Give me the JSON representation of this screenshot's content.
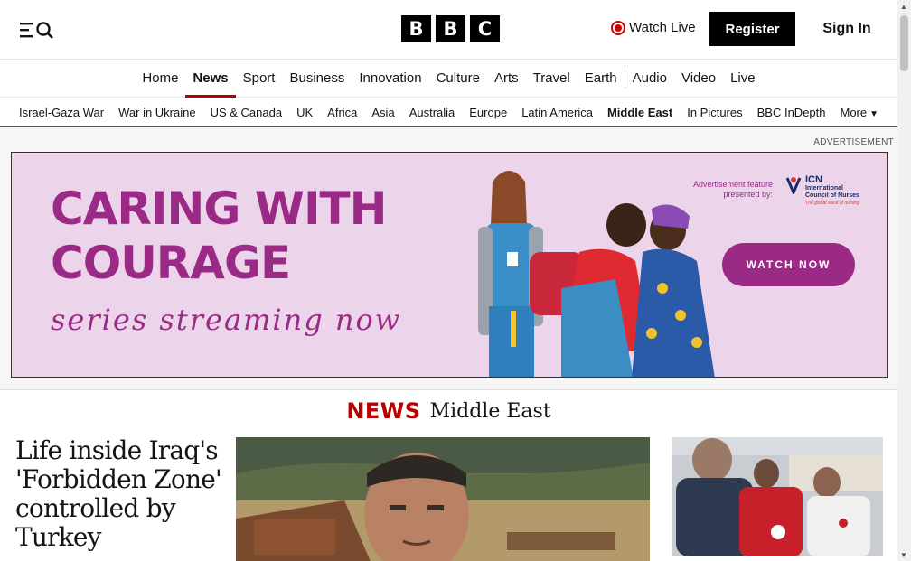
{
  "header": {
    "watch_live": "Watch Live",
    "register": "Register",
    "sign_in": "Sign In",
    "logo_letters": [
      "B",
      "B",
      "C"
    ]
  },
  "primary_nav": [
    "Home",
    "News",
    "Sport",
    "Business",
    "Innovation",
    "Culture",
    "Arts",
    "Travel",
    "Earth",
    "Audio",
    "Video",
    "Live"
  ],
  "primary_nav_active": "News",
  "secondary_nav": [
    "Israel-Gaza War",
    "War in Ukraine",
    "US & Canada",
    "UK",
    "Africa",
    "Asia",
    "Australia",
    "Europe",
    "Latin America",
    "Middle East",
    "In Pictures",
    "BBC InDepth"
  ],
  "secondary_nav_active": "Middle East",
  "secondary_nav_more": "More",
  "ad": {
    "label": "ADVERTISEMENT",
    "headline_line1": "CARING WITH",
    "headline_line2": "COURAGE",
    "script": "series streaming now",
    "feature_line1": "Advertisement feature",
    "feature_line2": "presented by:",
    "icn_abbr": "ICN",
    "icn_line1": "International",
    "icn_line2": "Council of Nurses",
    "icn_tagline": "The global voice of nursing",
    "cta": "WATCH NOW"
  },
  "section": {
    "brand": "NEWS",
    "title": "Middle East"
  },
  "lead_story": {
    "headline": "Life inside Iraq's 'Forbidden Zone' controlled by Turkey"
  },
  "colors": {
    "bbc_red": "#b80000",
    "ad_purple": "#9b2a86",
    "ad_background": "#ecd5ea",
    "live_red": "#d70000"
  },
  "icons": [
    "menu-icon",
    "search-icon",
    "live-icon",
    "chevron-down-icon"
  ]
}
